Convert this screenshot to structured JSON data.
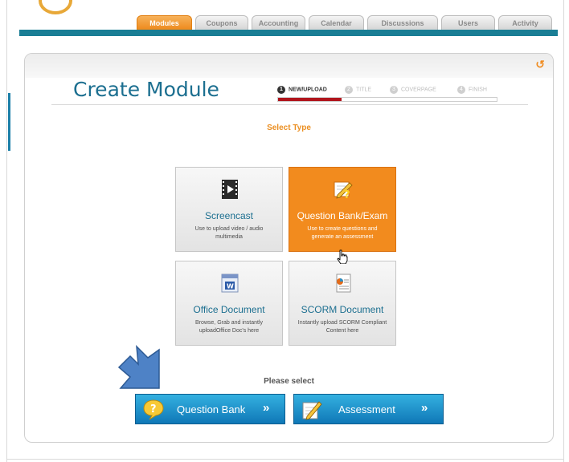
{
  "nav": {
    "tabs": [
      {
        "label": "Modules",
        "active": true
      },
      {
        "label": "Coupons"
      },
      {
        "label": "Accounting"
      },
      {
        "label": "Calendar"
      },
      {
        "label": "Discussions"
      },
      {
        "label": "Users"
      },
      {
        "label": "Activity"
      }
    ]
  },
  "page": {
    "title": "Create Module",
    "back_icon": "undo-arrow-icon"
  },
  "steps": [
    {
      "num": "1",
      "label": "NEW/UPLOAD",
      "active": true
    },
    {
      "num": "2",
      "label": "TITLE"
    },
    {
      "num": "3",
      "label": "COVERPAGE"
    },
    {
      "num": "4",
      "label": "FINISH"
    }
  ],
  "progress": {
    "fraction": 0.29
  },
  "select_type_label": "Select Type",
  "cards": [
    {
      "title": "Screencast",
      "desc": "Use to upload video / audio multimedia",
      "icon": "film-icon"
    },
    {
      "title": "Question Bank/Exam",
      "desc": "Use to create questions and generate an assessment",
      "icon": "exam-edit-icon",
      "selected": true
    },
    {
      "title": "Office Document",
      "desc": "Browse, Grab and instantly uploadOffice Doc's here",
      "icon": "word-document-icon"
    },
    {
      "title": "SCORM Document",
      "desc": "Instantly upload SCORM Compliant Content here",
      "icon": "scorm-document-icon"
    }
  ],
  "please_select": "Please select",
  "buttons": {
    "question_bank": {
      "label": "Question Bank",
      "chevron": "»"
    },
    "assessment": {
      "label": "Assessment",
      "chevron": "»"
    }
  },
  "colors": {
    "accent_orange": "#f28b1e",
    "title_blue": "#1c6f90",
    "teal_bar": "#1a7e95",
    "button_blue": "#1e8fca",
    "progress_red": "#b0151c"
  }
}
